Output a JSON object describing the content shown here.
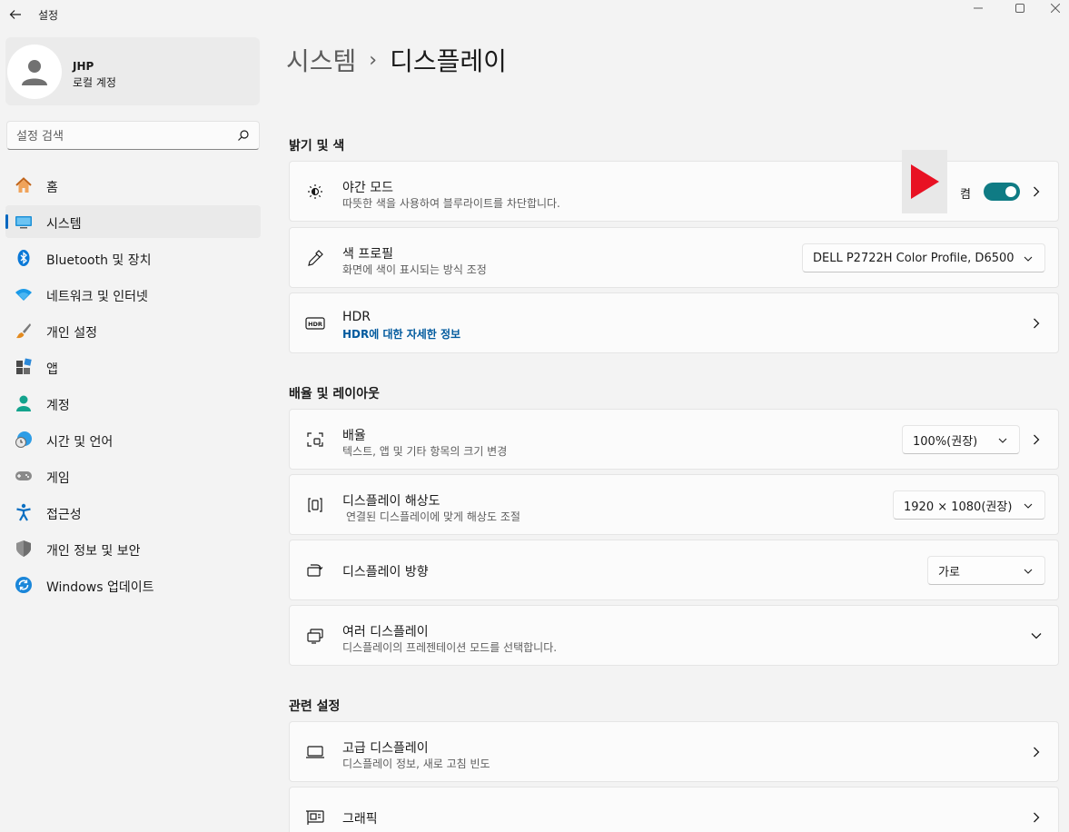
{
  "titlebar": {
    "app_title": "설정"
  },
  "profile": {
    "name": "JHP",
    "account_type": "로컬 계정"
  },
  "search": {
    "placeholder": "설정 검색"
  },
  "sidebar": {
    "items": [
      {
        "label": "홈",
        "icon": "home-icon"
      },
      {
        "label": "시스템",
        "icon": "system-icon",
        "selected": true
      },
      {
        "label": "Bluetooth 및 장치",
        "icon": "bluetooth-icon"
      },
      {
        "label": "네트워크 및 인터넷",
        "icon": "wifi-icon"
      },
      {
        "label": "개인 설정",
        "icon": "brush-icon"
      },
      {
        "label": "앱",
        "icon": "apps-icon"
      },
      {
        "label": "계정",
        "icon": "account-icon"
      },
      {
        "label": "시간 및 언어",
        "icon": "time-language-icon"
      },
      {
        "label": "게임",
        "icon": "gamepad-icon"
      },
      {
        "label": "접근성",
        "icon": "accessibility-icon"
      },
      {
        "label": "개인 정보 및 보안",
        "icon": "shield-icon"
      },
      {
        "label": "Windows 업데이트",
        "icon": "update-icon"
      }
    ]
  },
  "breadcrumb": {
    "parent": "시스템",
    "separator": "›",
    "current": "디스플레이"
  },
  "sections": {
    "brightness": {
      "title": "밝기 및 색",
      "night_mode": {
        "title": "야간 모드",
        "subtitle": "따뜻한 색을 사용하여 블루라이트를 차단합니다.",
        "toggle_state": "켬",
        "toggle_on": true
      },
      "color_profile": {
        "title": "색 프로필",
        "subtitle": "화면에 색이 표시되는 방식 조정",
        "value": "DELL P2722H Color Profile, D6500"
      },
      "hdr": {
        "title": "HDR",
        "link": "HDR에 대한 자세한 정보"
      }
    },
    "scale_layout": {
      "title": "배율 및 레이아웃",
      "scale": {
        "title": "배율",
        "subtitle": "텍스트, 앱 및 기타 항목의 크기 변경",
        "value": "100%(권장)"
      },
      "resolution": {
        "title": "디스플레이 해상도",
        "subtitle": "연결된 디스플레이에 맞게 해상도 조절",
        "value": "1920 × 1080(권장)"
      },
      "orientation": {
        "title": "디스플레이 방향",
        "value": "가로"
      },
      "multiple_displays": {
        "title": "여러 디스플레이",
        "subtitle": "디스플레이의 프레젠테이션 모드를 선택합니다."
      }
    },
    "related": {
      "title": "관련 설정",
      "advanced_display": {
        "title": "고급 디스플레이",
        "subtitle": "디스플레이 정보, 새로 고침 빈도"
      },
      "graphics": {
        "title": "그래픽"
      }
    }
  },
  "colors": {
    "accent": "#0f7b84",
    "link": "#005a9e",
    "overlay_play": "#e81123"
  }
}
